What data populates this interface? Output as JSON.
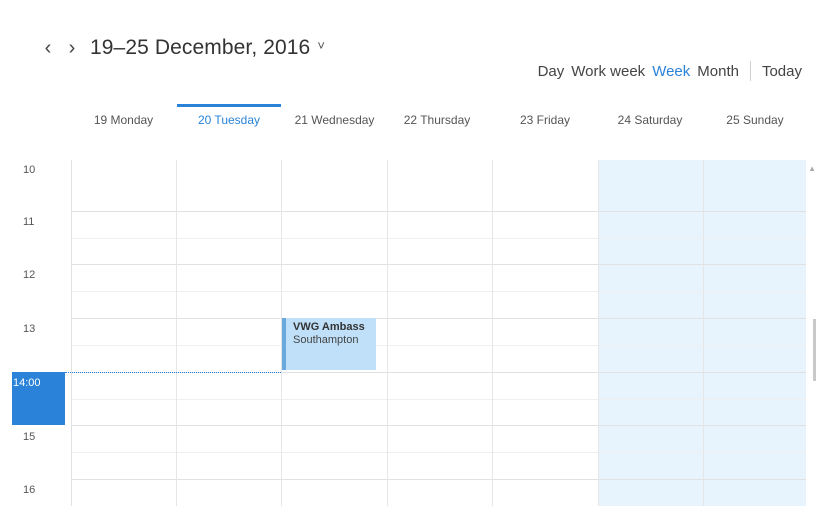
{
  "header": {
    "prev_icon": "chevron-left-icon",
    "next_icon": "chevron-right-icon",
    "prev_glyph": "‹",
    "next_glyph": "›",
    "range_title": "19–25 December, 2016",
    "dropdown_glyph": "˅",
    "dropdown_icon": "chevron-down-icon"
  },
  "views": {
    "day": "Day",
    "work_week": "Work week",
    "week": "Week",
    "month": "Month",
    "today": "Today",
    "active": "Week"
  },
  "days": [
    {
      "label": "19 Monday",
      "is_today": false
    },
    {
      "label": "20 Tuesday",
      "is_today": true
    },
    {
      "label": "21 Wednesday",
      "is_today": false
    },
    {
      "label": "22 Thursday",
      "is_today": false
    },
    {
      "label": "23 Friday",
      "is_today": false
    },
    {
      "label": "24 Saturday",
      "is_today": false
    },
    {
      "label": "25 Sunday",
      "is_today": false
    }
  ],
  "hours": [
    "10",
    "11",
    "12",
    "13",
    "14:00",
    "15",
    "16"
  ],
  "current_time": "14:00",
  "event": {
    "title": "VWG Ambass",
    "location": "Southampton",
    "day": "21 Wednesday",
    "start_hour": "13"
  },
  "colors": {
    "accent": "#2a83d8",
    "weekend_bg": "#e7f3fd",
    "event_bg": "#bfe0f8",
    "event_border": "#6aa9de"
  }
}
